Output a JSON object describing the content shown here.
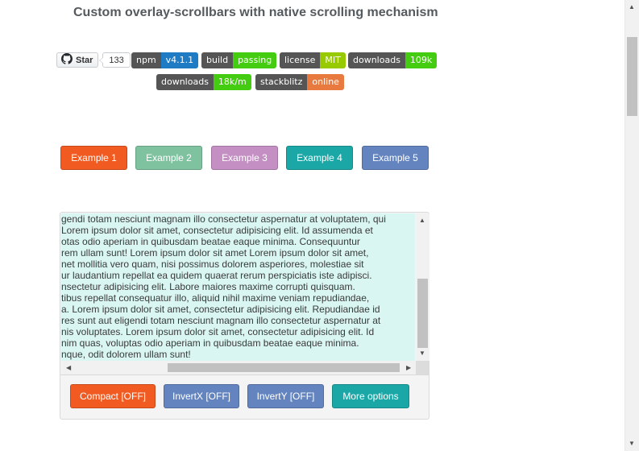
{
  "title": "Custom overlay-scrollbars with native scrolling mechanism",
  "github": {
    "star_label": "Star",
    "star_count": "133"
  },
  "badges": [
    {
      "label": "npm",
      "value": "v4.1.1",
      "color": "#1e7bc4"
    },
    {
      "label": "build",
      "value": "passing",
      "color": "#4c1"
    },
    {
      "label": "license",
      "value": "MIT",
      "color": "#97ca00"
    },
    {
      "label": "downloads",
      "value": "109k",
      "color": "#4c1"
    },
    {
      "label": "downloads",
      "value": "18k/m",
      "color": "#4c1"
    },
    {
      "label": "stackblitz",
      "value": "online",
      "color": "#e97a3f"
    }
  ],
  "examples": [
    {
      "label": "Example 1",
      "color": "#f15b22"
    },
    {
      "label": "Example 2",
      "color": "#7fc29f"
    },
    {
      "label": "Example 3",
      "color": "#c48fc3"
    },
    {
      "label": "Example 4",
      "color": "#1ba7a6"
    },
    {
      "label": "Example 5",
      "color": "#6384bf"
    }
  ],
  "demo_text": [
    "gendi totam nesciunt magnam illo consectetur aspernatur at voluptatem, qui",
    "Lorem ipsum dolor sit amet, consectetur adipisicing elit. Id assumenda et",
    "otas odio aperiam in quibusdam beatae eaque minima. Consequuntur",
    "rem ullam sunt! Lorem ipsum dolor sit amet Lorem ipsum dolor sit amet,",
    "net mollitia vero quam, nisi possimus dolorem asperiores, molestiae sit",
    "ur laudantium repellat ea quidem quaerat rerum perspiciatis iste adipisci.",
    "nsectetur adipisicing elit. Labore maiores maxime corrupti quisquam.",
    "tibus repellat consequatur illo, aliquid nihil maxime veniam repudiandae,",
    "a. Lorem ipsum dolor sit amet, consectetur adipisicing elit. Repudiandae id",
    "res sunt aut eligendi totam nesciunt magnam illo consectetur aspernatur at",
    "nis voluptates. Lorem ipsum dolor sit amet, consectetur adipisicing elit. Id",
    "nim quas, voluptas odio aperiam in quibusdam beatae eaque minima.",
    "nque, odit dolorem ullam sunt!"
  ],
  "controls": [
    {
      "label": "Compact [OFF]",
      "color": "#f15b22"
    },
    {
      "label": "InvertX [OFF]",
      "color": "#6384bf"
    },
    {
      "label": "InvertY [OFF]",
      "color": "#6384bf"
    },
    {
      "label": "More options",
      "color": "#1ba7a6"
    }
  ],
  "scroll_icons": {
    "up": "arrow-up-icon",
    "down": "arrow-down-icon",
    "left": "arrow-left-icon",
    "right": "arrow-right-icon"
  }
}
